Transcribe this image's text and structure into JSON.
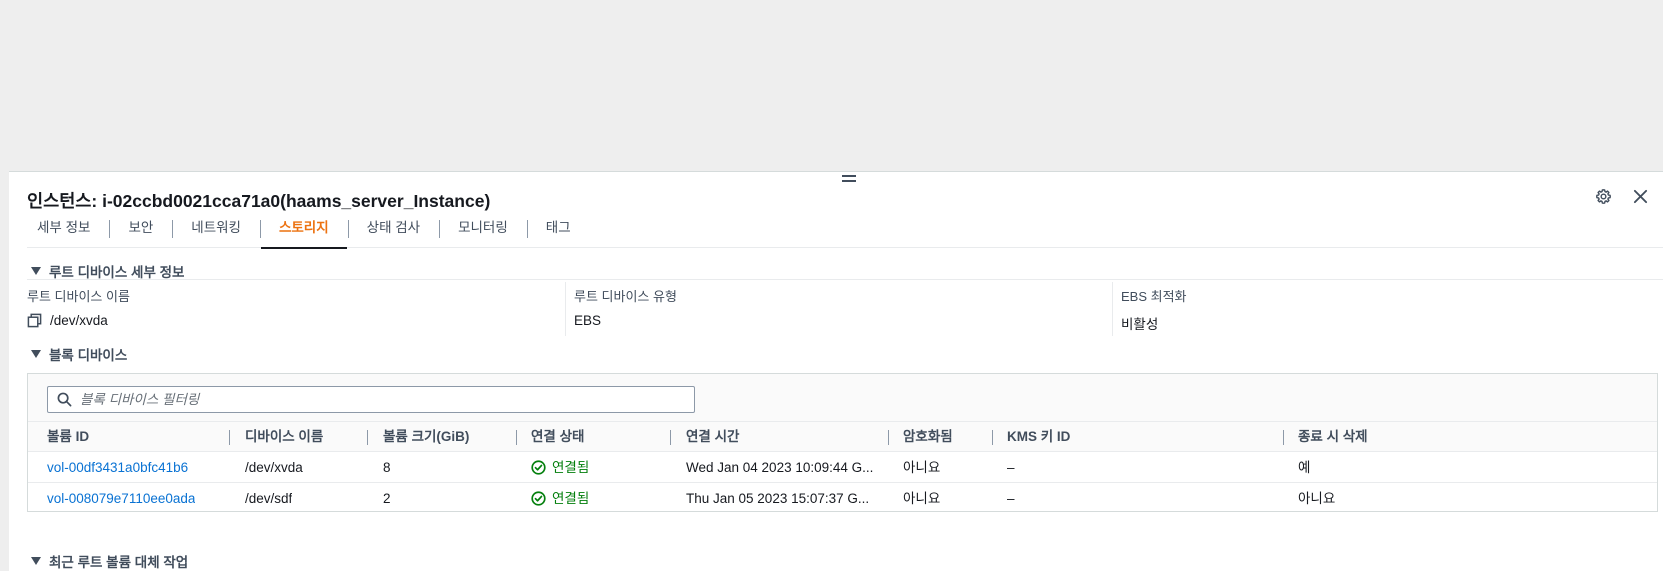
{
  "panel": {
    "title": "인스턴스: i-02ccbd0021cca71a0(haams_server_Instance)",
    "icons": {
      "settings": "gear-icon",
      "close": "close-icon",
      "drag": "drag-handle-icon"
    }
  },
  "tabs": [
    {
      "label": "세부 정보"
    },
    {
      "label": "보안"
    },
    {
      "label": "네트워킹"
    },
    {
      "label": "스토리지",
      "active": true
    },
    {
      "label": "상태 검사"
    },
    {
      "label": "모니터링"
    },
    {
      "label": "태그"
    }
  ],
  "root_device": {
    "section_title": "루트 디바이스 세부 정보",
    "name_label": "루트 디바이스 이름",
    "name_value": "/dev/xvda",
    "type_label": "루트 디바이스 유형",
    "type_value": "EBS",
    "ebs_label": "EBS 최적화",
    "ebs_value": "비활성"
  },
  "block_devices": {
    "section_title": "블록 디바이스",
    "search_placeholder": "블록 디바이스 필터링",
    "columns": [
      "볼륨 ID",
      "디바이스 이름",
      "볼륨 크기(GiB)",
      "연결 상태",
      "연결 시간",
      "암호화됨",
      "KMS 키 ID",
      "종료 시 삭제"
    ],
    "rows": [
      {
        "volume_id": "vol-00df3431a0bfc41b6",
        "device": "/dev/xvda",
        "size": "8",
        "status": "연결됨",
        "time": "Wed Jan 04 2023 10:09:44 G...",
        "encrypted": "아니요",
        "kms": "–",
        "delete_on_term": "예"
      },
      {
        "volume_id": "vol-008079e7110ee0ada",
        "device": "/dev/sdf",
        "size": "2",
        "status": "연결됨",
        "time": "Thu Jan 05 2023 15:07:37 G...",
        "encrypted": "아니요",
        "kms": "–",
        "delete_on_term": "아니요"
      }
    ],
    "status_color": "#037f0c",
    "link_color": "#0972d3"
  },
  "replacement": {
    "section_title": "최근 루트 볼륨 대체 작업"
  },
  "colors": {
    "active_tab": "#ec7211",
    "background_top": "#eeeeee"
  }
}
